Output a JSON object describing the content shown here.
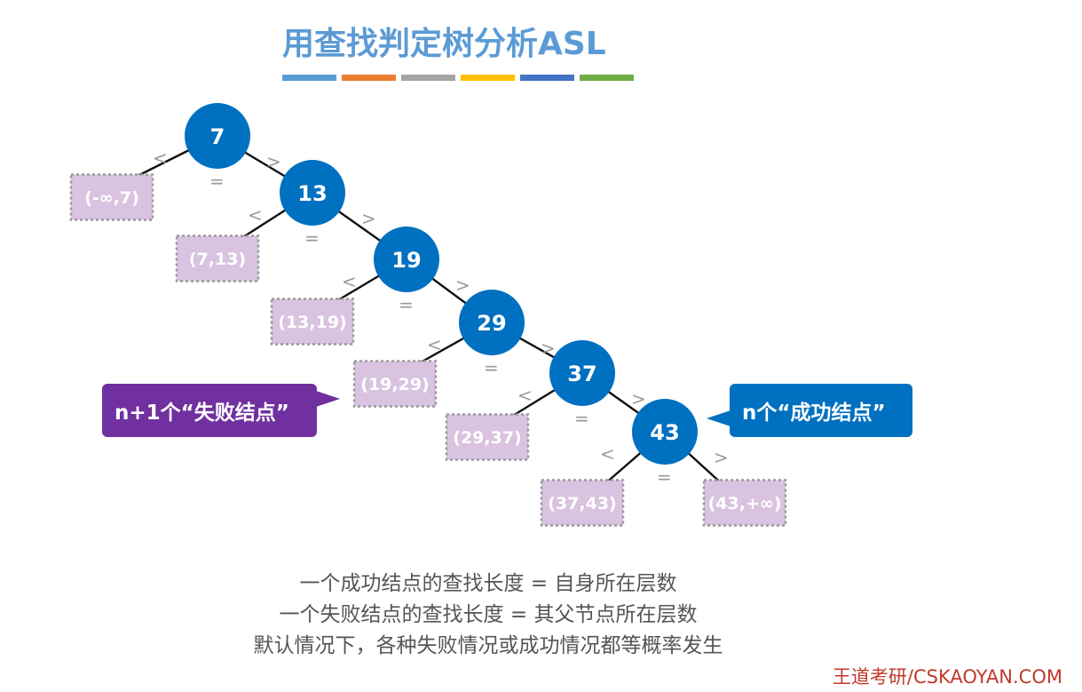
{
  "title": "用查找判定树分析ASL",
  "title_bar_colors": [
    "#5b9bd5",
    "#ed7d31",
    "#a5a5a5",
    "#ffc000",
    "#4472c4",
    "#70ad47"
  ],
  "tree": {
    "node_color": "#0070c0",
    "fail_fill": "#d9c3e0",
    "nodes": [
      "7",
      "13",
      "19",
      "29",
      "37",
      "43"
    ],
    "failure_nodes": [
      "(-∞,7)",
      "(7,13)",
      "(13,19)",
      "(19,29)",
      "(29,37)",
      "(37,43)",
      "(43,+∞)"
    ],
    "relations": {
      "less": "<",
      "equal": "=",
      "greater": ">"
    }
  },
  "callouts": {
    "failure": "n+1个“失败结点”",
    "success": "n个“成功结点”"
  },
  "notes": [
    "一个成功结点的查找长度 = 自身所在层数",
    "一个失败结点的查找长度 = 其父节点所在层数",
    "默认情况下，各种失败情况或成功情况都等概率发生"
  ],
  "footer": "王道考研/CSKAOYAN.COM"
}
